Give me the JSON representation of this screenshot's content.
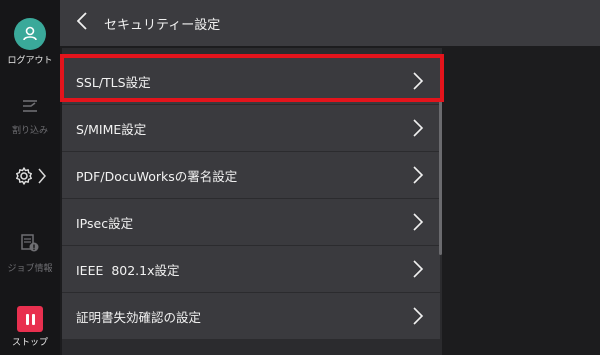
{
  "header": {
    "title": "セキュリティー設定"
  },
  "rail": {
    "logout_label": "ログアウト",
    "interrupt_label": "割り込み",
    "jobinfo_label": "ジョブ情報",
    "stop_label": "ストップ"
  },
  "items": [
    {
      "label": "SSL/TLS設定",
      "selected": true
    },
    {
      "label": "S/MIME設定"
    },
    {
      "label": "PDF/DocuWorksの署名設定"
    },
    {
      "label": "IPsec設定"
    },
    {
      "label": "IEEE  802.1x設定"
    },
    {
      "label": "証明書失効確認の設定"
    }
  ],
  "colors": {
    "accent_teal": "#3aa99a",
    "stop_red": "#e8304f",
    "highlight_red": "#e3141c"
  }
}
